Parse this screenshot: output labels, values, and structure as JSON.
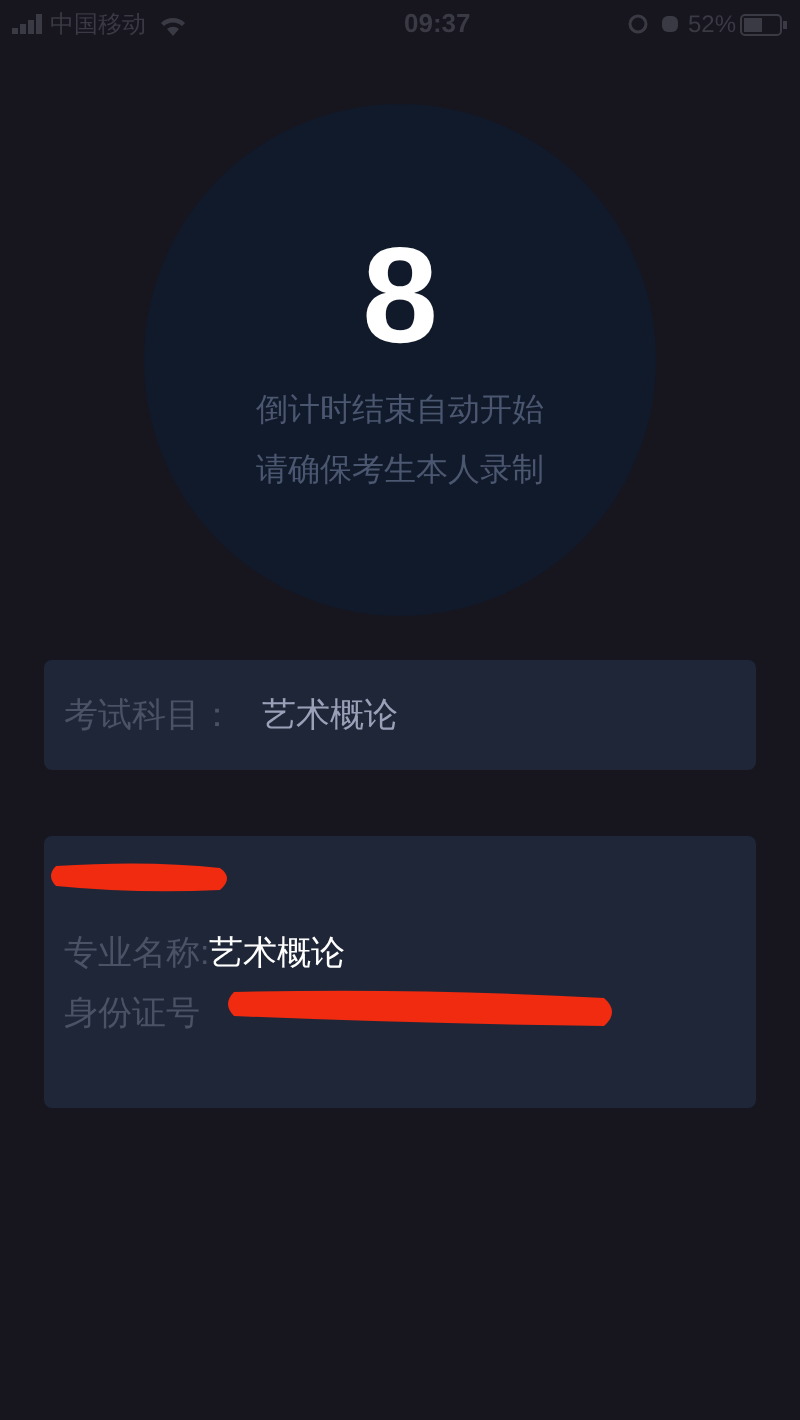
{
  "status_bar": {
    "carrier": "中国移动",
    "time": "09:37",
    "battery": "52%"
  },
  "countdown": {
    "number": "8",
    "lines": [
      "倒计时结束自动开始",
      "请确保考生本人录制"
    ]
  },
  "subject": {
    "label": "考试科目：",
    "value": "艺术概论"
  },
  "candidate": {
    "major_label": "专业名称:",
    "major_value": "艺术概论",
    "id_label": "身份证号"
  }
}
